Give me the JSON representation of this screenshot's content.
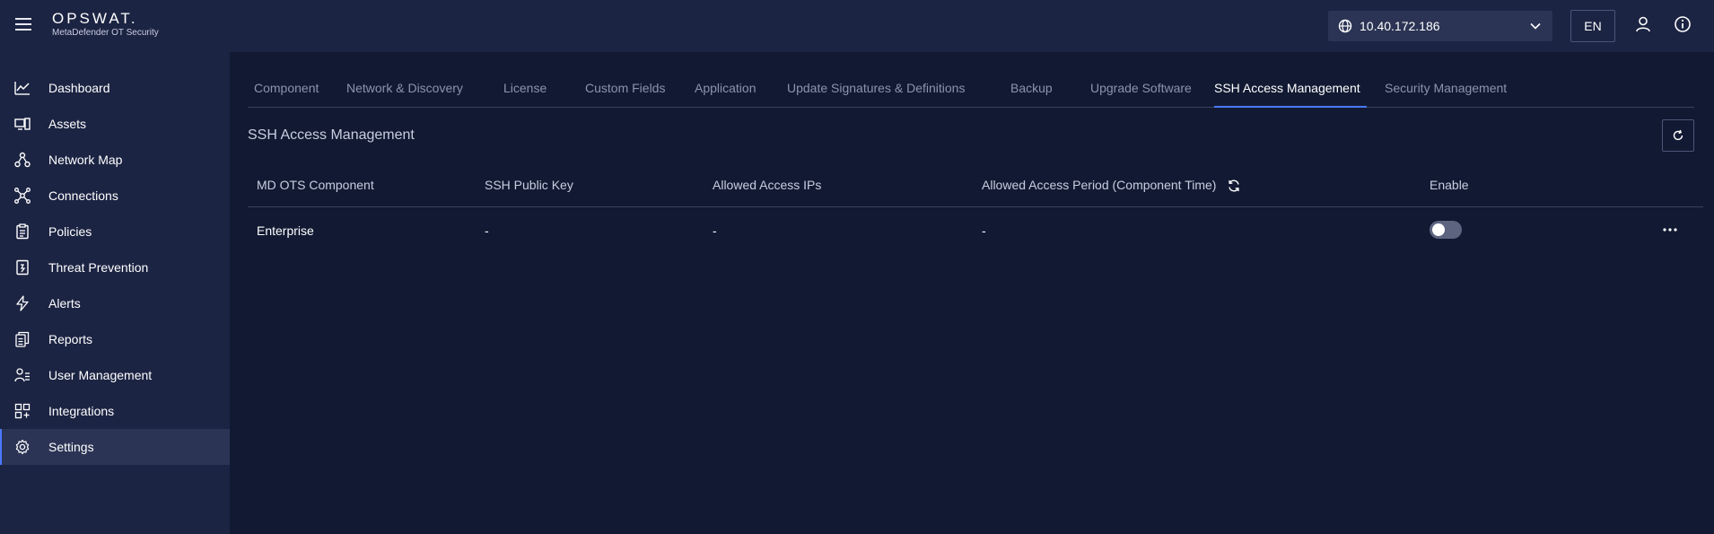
{
  "header": {
    "logo_word": "OPSWAT.",
    "logo_sub": "MetaDefender OT Security",
    "ip_value": "10.40.172.186",
    "lang_label": "EN"
  },
  "sidebar": {
    "items": [
      {
        "label": "Dashboard",
        "icon": "chart-line-icon"
      },
      {
        "label": "Assets",
        "icon": "assets-icon"
      },
      {
        "label": "Network Map",
        "icon": "network-map-icon"
      },
      {
        "label": "Connections",
        "icon": "connections-icon"
      },
      {
        "label": "Policies",
        "icon": "clipboard-icon"
      },
      {
        "label": "Threat Prevention",
        "icon": "threat-prevention-icon"
      },
      {
        "label": "Alerts",
        "icon": "lightning-icon"
      },
      {
        "label": "Reports",
        "icon": "reports-icon"
      },
      {
        "label": "User Management",
        "icon": "user-management-icon"
      },
      {
        "label": "Integrations",
        "icon": "integrations-icon"
      },
      {
        "label": "Settings",
        "icon": "gear-icon"
      }
    ],
    "active": "Settings"
  },
  "tabs": [
    "Component",
    "Network & Discovery",
    "License",
    "Custom Fields",
    "Application",
    "Update Signatures & Definitions",
    "Backup",
    "Upgrade Software",
    "SSH Access Management",
    "Security Management"
  ],
  "active_tab": "SSH Access Management",
  "main": {
    "title": "SSH Access Management",
    "columns": [
      "MD OTS Component",
      "SSH Public Key",
      "Allowed Access IPs",
      "Allowed Access Period (Component Time)",
      "Enable"
    ],
    "rows": [
      {
        "component": "Enterprise",
        "ssh_key": "-",
        "allowed_ips": "-",
        "allowed_period": "-",
        "enabled": false
      }
    ]
  },
  "colors": {
    "background": "#121a33",
    "panel": "#1c2443",
    "accent": "#4a78ff"
  }
}
